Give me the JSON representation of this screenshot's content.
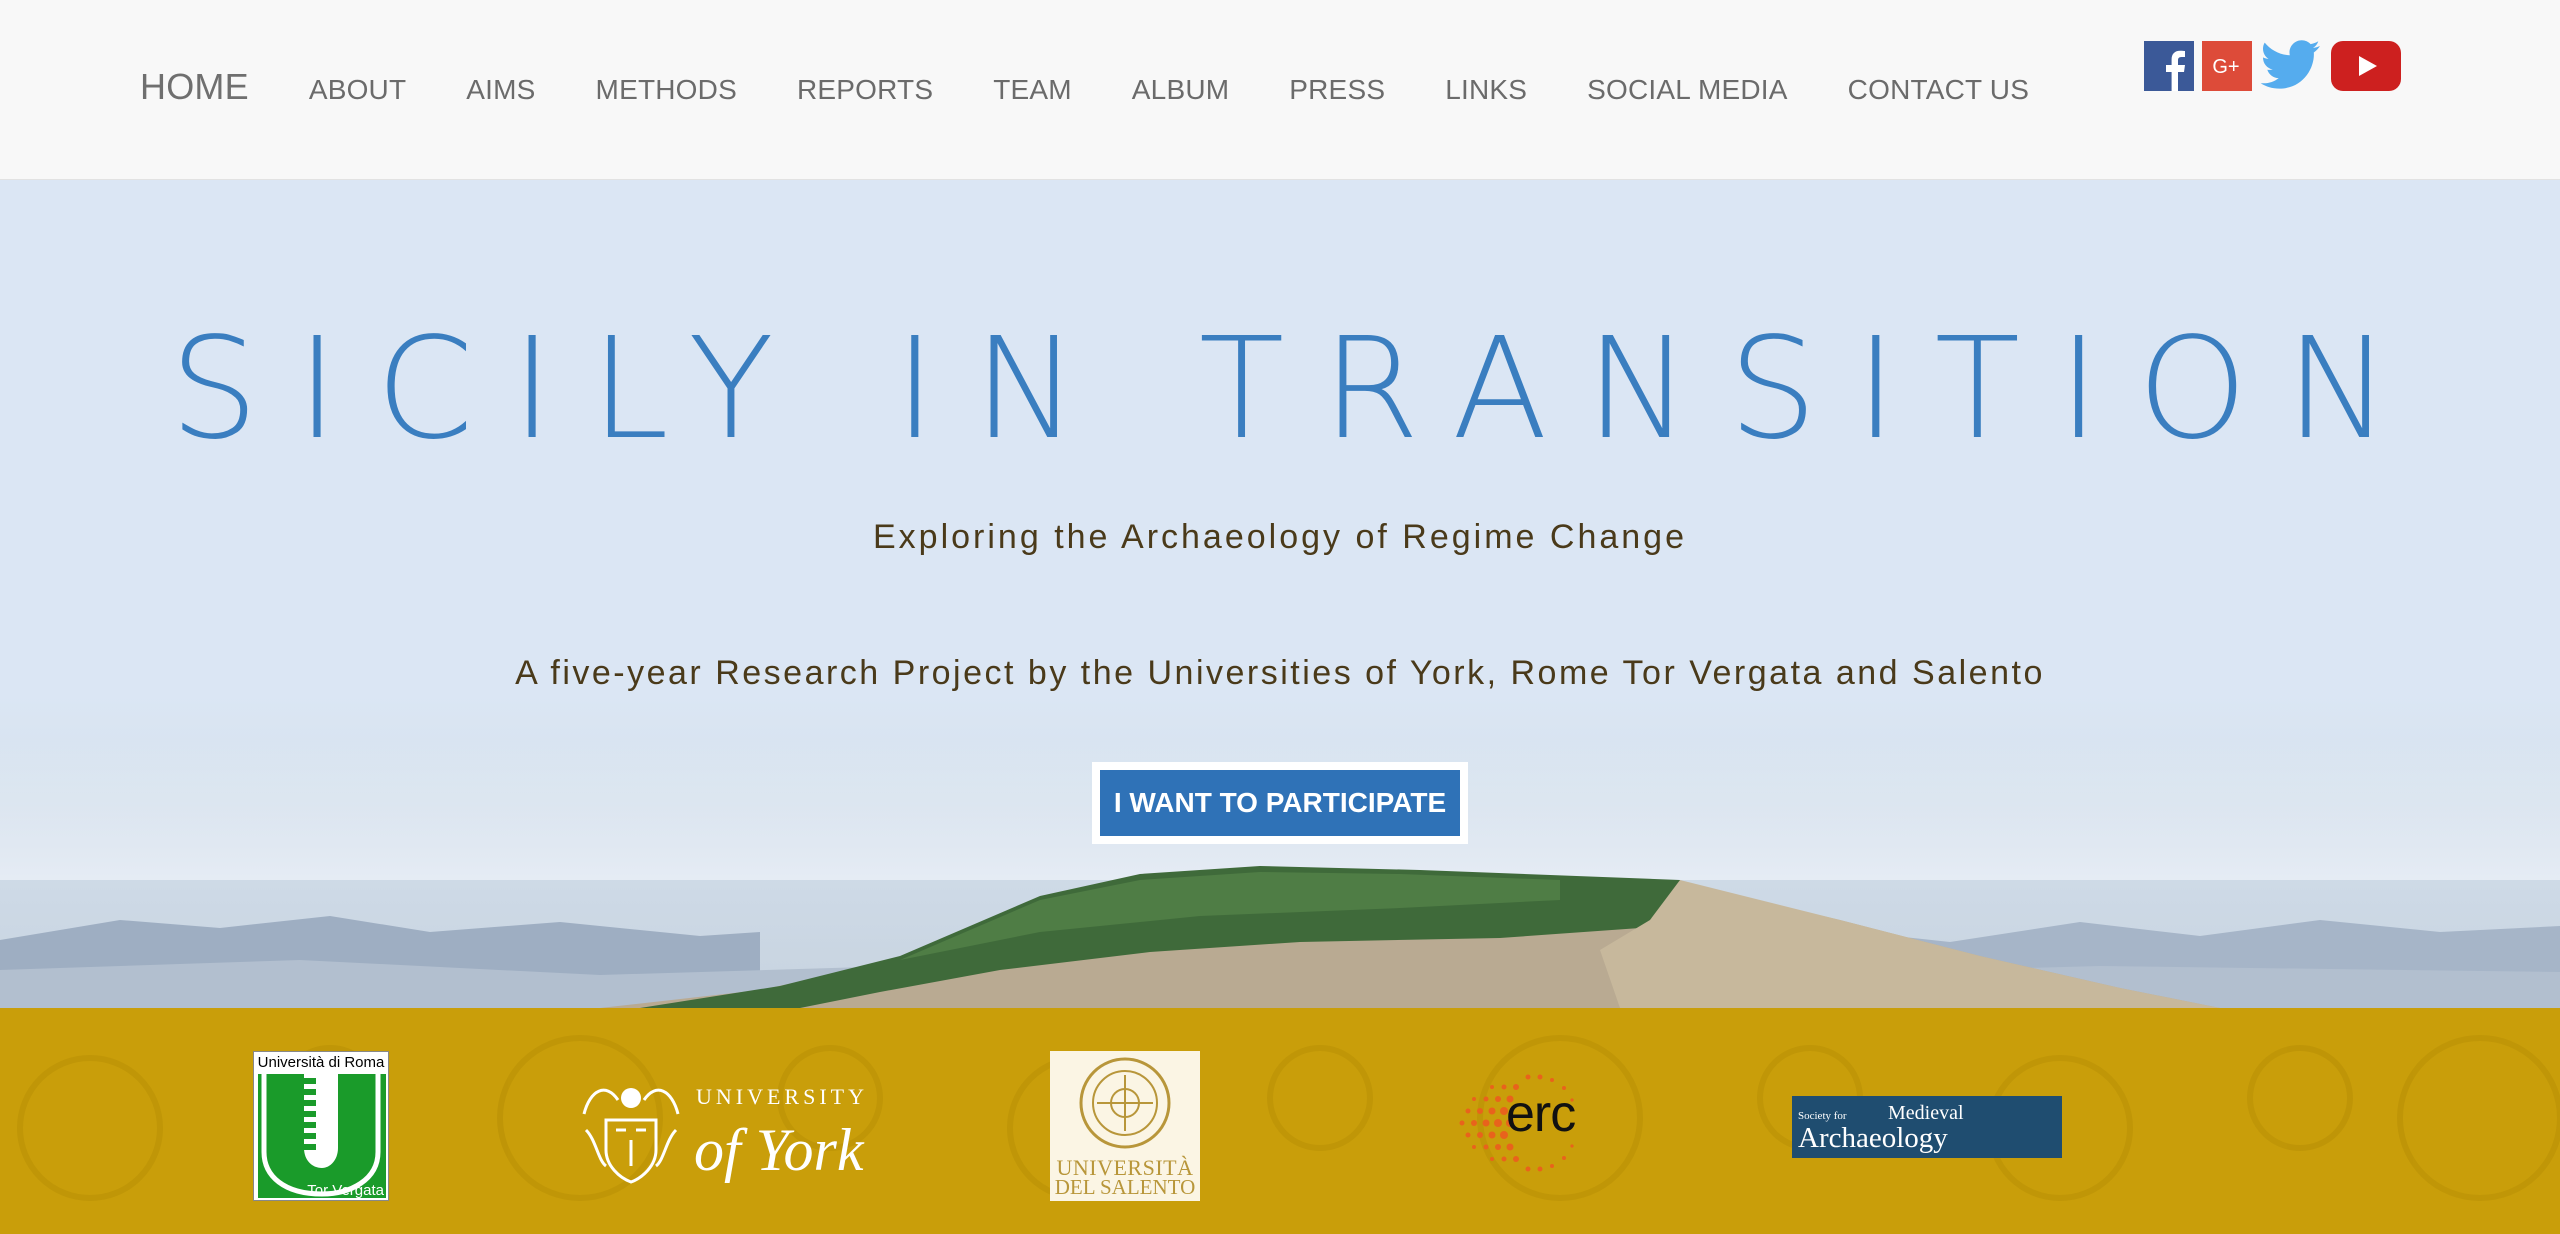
{
  "nav": {
    "items": [
      "HOME",
      "ABOUT",
      "AIMS",
      "METHODS",
      "REPORTS",
      "TEAM",
      "ALBUM",
      "PRESS",
      "LINKS",
      "SOCIAL MEDIA",
      "CONTACT US"
    ]
  },
  "social": {
    "icons": [
      "facebook-icon",
      "google-plus-icon",
      "twitter-icon",
      "youtube-icon"
    ],
    "colors": {
      "facebook": "#3b5998",
      "google_plus": "#dd4b39",
      "twitter": "#55acee",
      "youtube": "#cd201f"
    }
  },
  "hero": {
    "title": "SICILY IN TRANSITION",
    "subtitle": "Exploring the Archaeology of Regime Change",
    "description": "A five-year Research Project by the Universities of York, Rome Tor Vergata and Salento",
    "cta_label": "I WANT TO PARTICIPATE",
    "title_color": "#3a7ec0",
    "cta_color": "#2f72b7"
  },
  "partners": {
    "strip_color": "#c99e0a",
    "tor_vergata": {
      "top": "Università di Roma",
      "bottom": "Tor Vergata"
    },
    "york": {
      "line1": "UNIVERSITY",
      "line2": "of York"
    },
    "salento": {
      "line1": "UNIVERSITÀ",
      "line2": "DEL SALENTO"
    },
    "erc": {
      "text": "erc"
    },
    "sma": {
      "small": "Society for",
      "medieval": "Medieval",
      "archaeology": "Archaeology"
    }
  }
}
